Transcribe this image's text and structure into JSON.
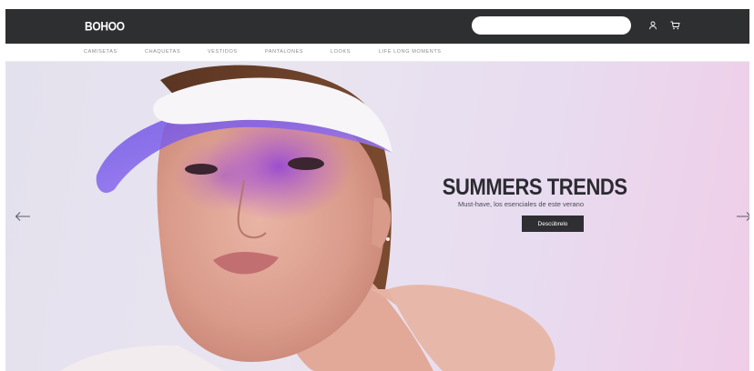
{
  "header": {
    "logo": "BOHOO",
    "search_placeholder": "",
    "icons": [
      "user-icon",
      "cart-icon"
    ]
  },
  "nav": {
    "items": [
      "CAMISETAS",
      "CHAQUETAS",
      "VESTIDOS",
      "PANTALONES",
      "LOOKS",
      "LIFE LONG MOMENTS"
    ]
  },
  "hero": {
    "title": "SUMMERS TRENDS",
    "subtitle": "Must-have, los esenciales de este verano",
    "button_label": "Descúbrelo",
    "prev_icon": "arrow-left-icon",
    "next_icon": "arrow-right-icon"
  },
  "colors": {
    "header_bg": "#2e2f31",
    "button_bg": "#2f2f33",
    "hero_bg": "#e6e1ee"
  }
}
